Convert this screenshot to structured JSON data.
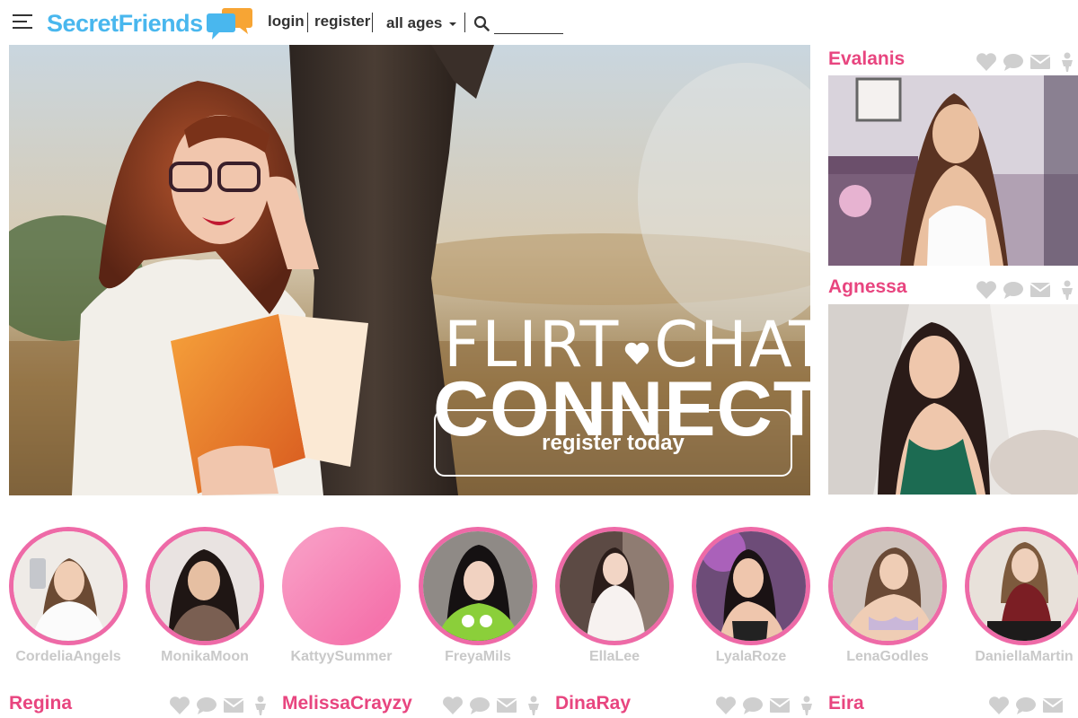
{
  "header": {
    "logo_part1": "Secret",
    "logo_part2": "Friends",
    "login_label": "login",
    "register_label": "register",
    "ages_label": "all ages",
    "search_placeholder": "",
    "icons": [
      "menu-icon",
      "search-icon",
      "caret-down-icon"
    ]
  },
  "hero": {
    "line1_left": "FLIRT",
    "line1_right": "CHAT",
    "line2": "CONNECT",
    "button_label": "register today"
  },
  "side_cards": [
    {
      "name": "Evalanis"
    },
    {
      "name": "Agnessa"
    }
  ],
  "card_icons": [
    "heart-icon",
    "chat-icon",
    "mail-icon",
    "person-icon"
  ],
  "circles": [
    {
      "name": "CordeliaAngels"
    },
    {
      "name": "MonikaMoon"
    },
    {
      "name": "KattyySummer"
    },
    {
      "name": "FreyaMils"
    },
    {
      "name": "EllaLee"
    },
    {
      "name": "LyalaRoze"
    },
    {
      "name": "LenaGodles"
    },
    {
      "name": "DaniellaMartin"
    }
  ],
  "bottom_row": [
    {
      "name": "Regina"
    },
    {
      "name": "MelissaCrayzy"
    },
    {
      "name": "DinaRay"
    },
    {
      "name": "Eira"
    }
  ],
  "colors": {
    "brand_blue": "#49b7ee",
    "brand_orange": "#f7a534",
    "accent_pink": "#e8457f",
    "ring_pink": "#ee6aa7",
    "icon_gray": "#cfcfcf",
    "circle_name_gray": "#c9c9c9"
  }
}
